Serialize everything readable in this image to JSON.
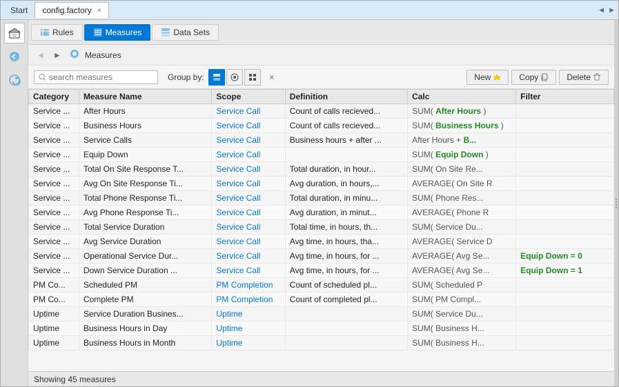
{
  "titlebar": {
    "start_label": "Start",
    "tab_label": "config.factory",
    "close_icon": "×",
    "arrow_left": "◄",
    "arrow_right": "►"
  },
  "toolbar": {
    "rules_label": "Rules",
    "measures_label": "Measures",
    "datasets_label": "Data Sets"
  },
  "navbar": {
    "back_arrow": "◄",
    "forward_arrow": "►",
    "breadcrumb_icon": "⊙",
    "breadcrumb_text": "Measures"
  },
  "filterbar": {
    "search_placeholder": "search measures",
    "groupby_label": "Group by:",
    "clear_icon": "×",
    "new_label": "New",
    "copy_label": "Copy",
    "delete_label": "Delete"
  },
  "table": {
    "columns": [
      "Category",
      "Measure Name",
      "Scope",
      "Definition",
      "Calc",
      "Filter"
    ],
    "rows": [
      {
        "category": "Service ...",
        "name": "After Hours",
        "scope": "Service Call",
        "definition": "Count of calls recieved...",
        "calc": "SUM( After Hours )",
        "filter": ""
      },
      {
        "category": "Service ...",
        "name": "Business Hours",
        "scope": "Service Call",
        "definition": "Count of calls recieved...",
        "calc": "SUM( Business Hours )",
        "filter": ""
      },
      {
        "category": "Service ...",
        "name": "Service Calls",
        "scope": "Service Call",
        "definition": "Business hours + after ...",
        "calc": "After Hours + B...",
        "filter": ""
      },
      {
        "category": "Service ...",
        "name": "Equip Down",
        "scope": "Service Call",
        "definition": "",
        "calc": "SUM( Equip Down )",
        "filter": ""
      },
      {
        "category": "Service ...",
        "name": "Total On Site Response T...",
        "scope": "Service Call",
        "definition": "Total duration, in hour...",
        "calc": "SUM( On Site Re...",
        "filter": ""
      },
      {
        "category": "Service ...",
        "name": "Avg On Site Response Ti...",
        "scope": "Service Call",
        "definition": "Avg duration, in hours,...",
        "calc": "AVERAGE( On Site R",
        "filter": ""
      },
      {
        "category": "Service ...",
        "name": "Total Phone Response Ti...",
        "scope": "Service Call",
        "definition": "Total duration, in minu...",
        "calc": "SUM( Phone Res...",
        "filter": ""
      },
      {
        "category": "Service ...",
        "name": "Avg Phone Response Ti...",
        "scope": "Service Call",
        "definition": "Avg duration, in minut...",
        "calc": "AVERAGE( Phone R",
        "filter": ""
      },
      {
        "category": "Service ...",
        "name": "Total Service Duration",
        "scope": "Service Call",
        "definition": "Total time, in hours, th...",
        "calc": "SUM( Service Du...",
        "filter": ""
      },
      {
        "category": "Service ...",
        "name": "Avg Service Duration",
        "scope": "Service Call",
        "definition": "Avg time, in hours, tha...",
        "calc": "AVERAGE( Service D",
        "filter": ""
      },
      {
        "category": "Service ...",
        "name": "Operational Service Dur...",
        "scope": "Service Call",
        "definition": "Avg time, in hours, for ...",
        "calc": "AVERAGE( Avg Se...",
        "filter": "Equip Down = 0"
      },
      {
        "category": "Service ...",
        "name": "Down Service Duration ...",
        "scope": "Service Call",
        "definition": "Avg time, in hours, for ...",
        "calc": "AVERAGE( Avg Se...",
        "filter": "Equip Down = 1"
      },
      {
        "category": "PM Co...",
        "name": "Scheduled PM",
        "scope": "PM Completion",
        "definition": "Count of scheduled pl...",
        "calc": "SUM( Scheduled P",
        "filter": ""
      },
      {
        "category": "PM Co...",
        "name": "Complete PM",
        "scope": "PM Completion",
        "definition": "Count of completed pl...",
        "calc": "SUM( PM Compl...",
        "filter": ""
      },
      {
        "category": "Uptime",
        "name": "Service Duration Busines...",
        "scope": "Uptime",
        "definition": "",
        "calc": "SUM( Service Du...",
        "filter": ""
      },
      {
        "category": "Uptime",
        "name": "Business Hours in Day",
        "scope": "Uptime",
        "definition": "",
        "calc": "SUM( Business H...",
        "filter": ""
      },
      {
        "category": "Uptime",
        "name": "Business Hours in Month",
        "scope": "Uptime",
        "definition": "",
        "calc": "SUM( Business H...",
        "filter": ""
      }
    ]
  },
  "statusbar": {
    "text": "Showing 45 measures"
  },
  "left_icons": [
    {
      "name": "home-icon",
      "symbol": "⌂"
    },
    {
      "name": "back-icon",
      "symbol": "←"
    },
    {
      "name": "refresh-icon",
      "symbol": "↻"
    }
  ]
}
